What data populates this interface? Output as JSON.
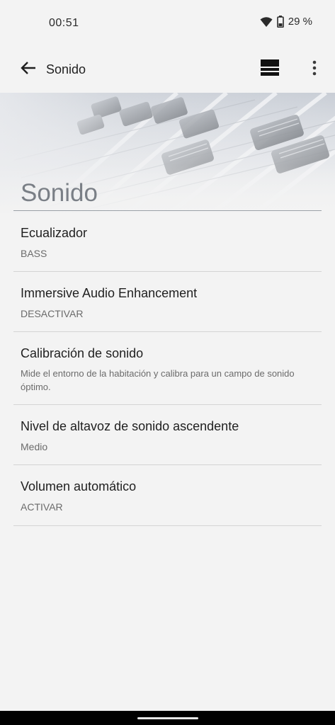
{
  "status_bar": {
    "time": "00:51",
    "battery_text": "29 %",
    "icons": [
      "wifi-icon",
      "battery-icon"
    ]
  },
  "app_bar": {
    "title": "Sonido",
    "back_icon": "arrow-back-icon",
    "view_icon": "view-list-icon",
    "menu_icon": "more-vert-icon"
  },
  "header": {
    "title": "Sonido",
    "image": "audio-mixer-faders"
  },
  "items": [
    {
      "title": "Ecualizador",
      "subtitle": "BASS"
    },
    {
      "title": "Immersive Audio Enhancement",
      "subtitle": "DESACTIVAR"
    },
    {
      "title": "Calibración de sonido",
      "subtitle": "Mide el entorno de la habitación y calibra para un campo de sonido óptimo."
    },
    {
      "title": "Nivel de altavoz de sonido ascendente",
      "subtitle": "Medio"
    },
    {
      "title": "Volumen automático",
      "subtitle": "ACTIVAR"
    }
  ],
  "colors": {
    "background": "#f3f3f3",
    "header_title": "#7a7f86",
    "nav_bar": "#000000"
  }
}
